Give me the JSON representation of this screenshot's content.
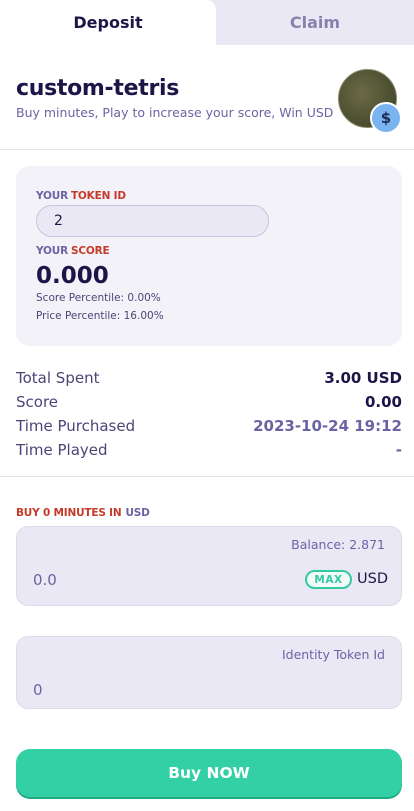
{
  "tabs": {
    "deposit": "Deposit",
    "claim": "Claim"
  },
  "header": {
    "title": "custom-tetris",
    "subtitle": "Buy minutes, Play to increase your score, Win USD",
    "coin_symbol": "$"
  },
  "token_card": {
    "token_label_prefix": "YOUR",
    "token_label_highlight": "TOKEN ID",
    "token_id_value": "2",
    "score_label_prefix": "YOUR",
    "score_label_highlight": "SCORE",
    "score_value": "0.000",
    "score_percentile": "Score Percentile: 0.00%",
    "price_percentile": "Price Percentile: 16.00%"
  },
  "stats": [
    {
      "label": "Total Spent",
      "value": "3.00 USD"
    },
    {
      "label": "Score",
      "value": "0.00"
    },
    {
      "label": "Time Purchased",
      "value": "2023-10-24 19:12"
    },
    {
      "label": "Time Played",
      "value": "-"
    }
  ],
  "buy": {
    "label": "BUY 0 MINUTES IN",
    "unit": "USD",
    "balance": "Balance: 2.871",
    "amount_value": "0.0",
    "max_label": "MAX",
    "currency": "USD"
  },
  "identity": {
    "hint": "Identity Token Id",
    "value": "0"
  },
  "buy_button": "Buy NOW",
  "colors": {
    "accent_green": "#33cfa5",
    "highlight_red": "#c63a2a",
    "text_dark": "#1d1447",
    "text_muted": "#6b64a4"
  }
}
